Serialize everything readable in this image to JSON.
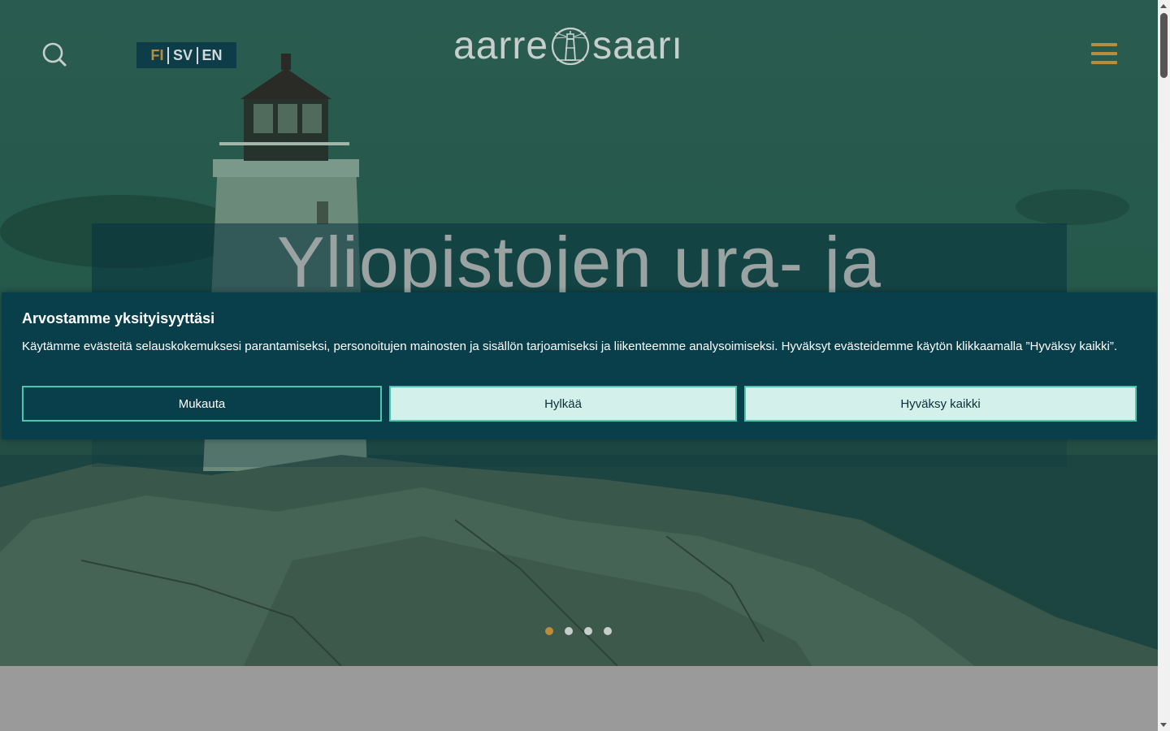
{
  "header": {
    "search_icon": "search-icon",
    "languages": [
      {
        "code": "FI",
        "active": true
      },
      {
        "code": "SV",
        "active": false
      },
      {
        "code": "EN",
        "active": false
      }
    ],
    "logo_left": "aarre",
    "logo_right": "saarı",
    "menu_icon": "hamburger-icon"
  },
  "hero": {
    "headline": "Yliopistojen ura- ja",
    "carousel": {
      "slide_count": 4,
      "active_index": 0
    }
  },
  "cookie_banner": {
    "title": "Arvostamme yksityisyyttäsi",
    "body": "Käytämme evästeitä selauskokemuksesi parantamiseksi, personoitujen mainosten ja sisällön tarjoamiseksi ja liikenteemme analysoimiseksi. Hyväksyt evästeidemme käytön klikkaamalla ”Hyväksy kaikki”.",
    "customize_label": "Mukauta",
    "reject_label": "Hylkää",
    "accept_label": "Hyväksy kaikki"
  },
  "colors": {
    "accent": "#b98d3c",
    "overlay": "#083f4b",
    "button_border": "#4ec6ad",
    "button_fill": "#d4f0ea"
  }
}
